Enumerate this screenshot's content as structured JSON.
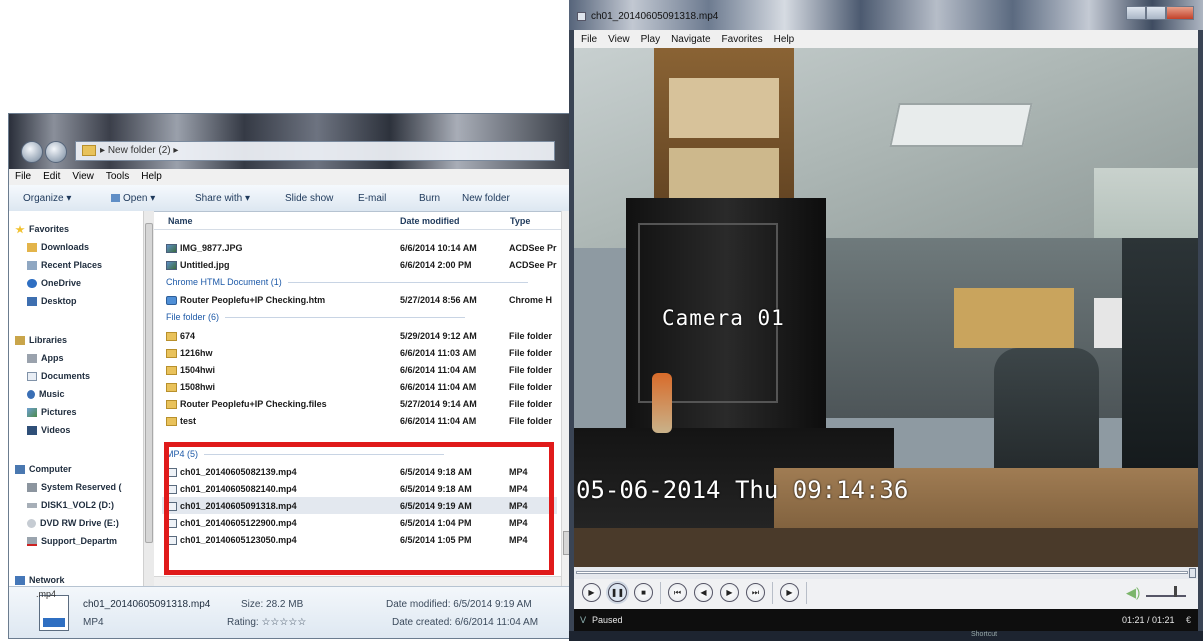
{
  "explorer": {
    "address": "New folder (2)",
    "menu": [
      "File",
      "Edit",
      "View",
      "Tools",
      "Help"
    ],
    "toolbar": {
      "organize": "Organize ▾",
      "open": "Open ▾",
      "share": "Share with ▾",
      "slideshow": "Slide show",
      "email": "E-mail",
      "burn": "Burn",
      "new_folder": "New folder"
    },
    "nav": {
      "favorites": "Favorites",
      "downloads": "Downloads",
      "recent": "Recent Places",
      "onedrive": "OneDrive",
      "desktop": "Desktop",
      "libraries": "Libraries",
      "apps": "Apps",
      "documents": "Documents",
      "music": "Music",
      "pictures": "Pictures",
      "videos": "Videos",
      "computer": "Computer",
      "sysres": "System Reserved (",
      "disk1": "DISK1_VOL2 (D:)",
      "dvd": "DVD RW Drive (E:)",
      "support": "Support_Departm",
      "network": "Network"
    },
    "columns": {
      "name": "Name",
      "date": "Date modified",
      "type": "Type"
    },
    "groups": {
      "chrome": "Chrome HTML Document (1)",
      "folder": "File folder (6)",
      "mp4": "MP4 (5)"
    },
    "files": {
      "img9877": {
        "name": "IMG_9877.JPG",
        "date": "6/6/2014 10:14 AM",
        "type": "ACDSee Pr"
      },
      "untitled": {
        "name": "Untitled.jpg",
        "date": "6/6/2014 2:00 PM",
        "type": "ACDSee Pr"
      },
      "router_htm": {
        "name": "Router Peoplefu+IP Checking.htm",
        "date": "5/27/2014 8:56 AM",
        "type": "Chrome H"
      },
      "f674": {
        "name": "674",
        "date": "5/29/2014 9:12 AM",
        "type": "File folder"
      },
      "f1216": {
        "name": "1216hw",
        "date": "6/6/2014 11:03 AM",
        "type": "File folder"
      },
      "f1504": {
        "name": "1504hwi",
        "date": "6/6/2014 11:04 AM",
        "type": "File folder"
      },
      "f1508": {
        "name": "1508hwi",
        "date": "6/6/2014 11:04 AM",
        "type": "File folder"
      },
      "router_files": {
        "name": "Router Peoplefu+IP Checking.files",
        "date": "5/27/2014 9:14 AM",
        "type": "File folder"
      },
      "ftest": {
        "name": "test",
        "date": "6/6/2014 11:04 AM",
        "type": "File folder"
      },
      "mp4_1": {
        "name": "ch01_20140605082139.mp4",
        "date": "6/5/2014 9:18 AM",
        "type": "MP4"
      },
      "mp4_2": {
        "name": "ch01_20140605082140.mp4",
        "date": "6/5/2014 9:18 AM",
        "type": "MP4"
      },
      "mp4_3": {
        "name": "ch01_20140605091318.mp4",
        "date": "6/5/2014 9:19 AM",
        "type": "MP4"
      },
      "mp4_4": {
        "name": "ch01_20140605122900.mp4",
        "date": "6/5/2014 1:04 PM",
        "type": "MP4"
      },
      "mp4_5": {
        "name": "ch01_20140605123050.mp4",
        "date": "6/5/2014 1:05 PM",
        "type": "MP4"
      }
    },
    "details": {
      "thumb_label": ".mp4",
      "filename": "ch01_20140605091318.mp4",
      "filetype": "MP4",
      "size": "Size: 28.2 MB",
      "rating": "Rating: ☆☆☆☆☆",
      "modified": "Date modified: 6/5/2014 9:19 AM",
      "created": "Date created: 6/6/2014 11:04 AM"
    }
  },
  "player": {
    "title": "ch01_20140605091318.mp4",
    "menu": [
      "File",
      "View",
      "Play",
      "Navigate",
      "Favorites",
      "Help"
    ],
    "osd_camera": "Camera 01",
    "osd_timestamp": "05-06-2014 Thu 09:14:36",
    "status": "Paused",
    "time": "01:21 / 01:21",
    "bottom_label": "Shortcut"
  },
  "colors": {
    "highlight": "#e01a1a",
    "explorer_toolbar": "#dde7f1",
    "player_status_bg": "#0e0e0e"
  }
}
